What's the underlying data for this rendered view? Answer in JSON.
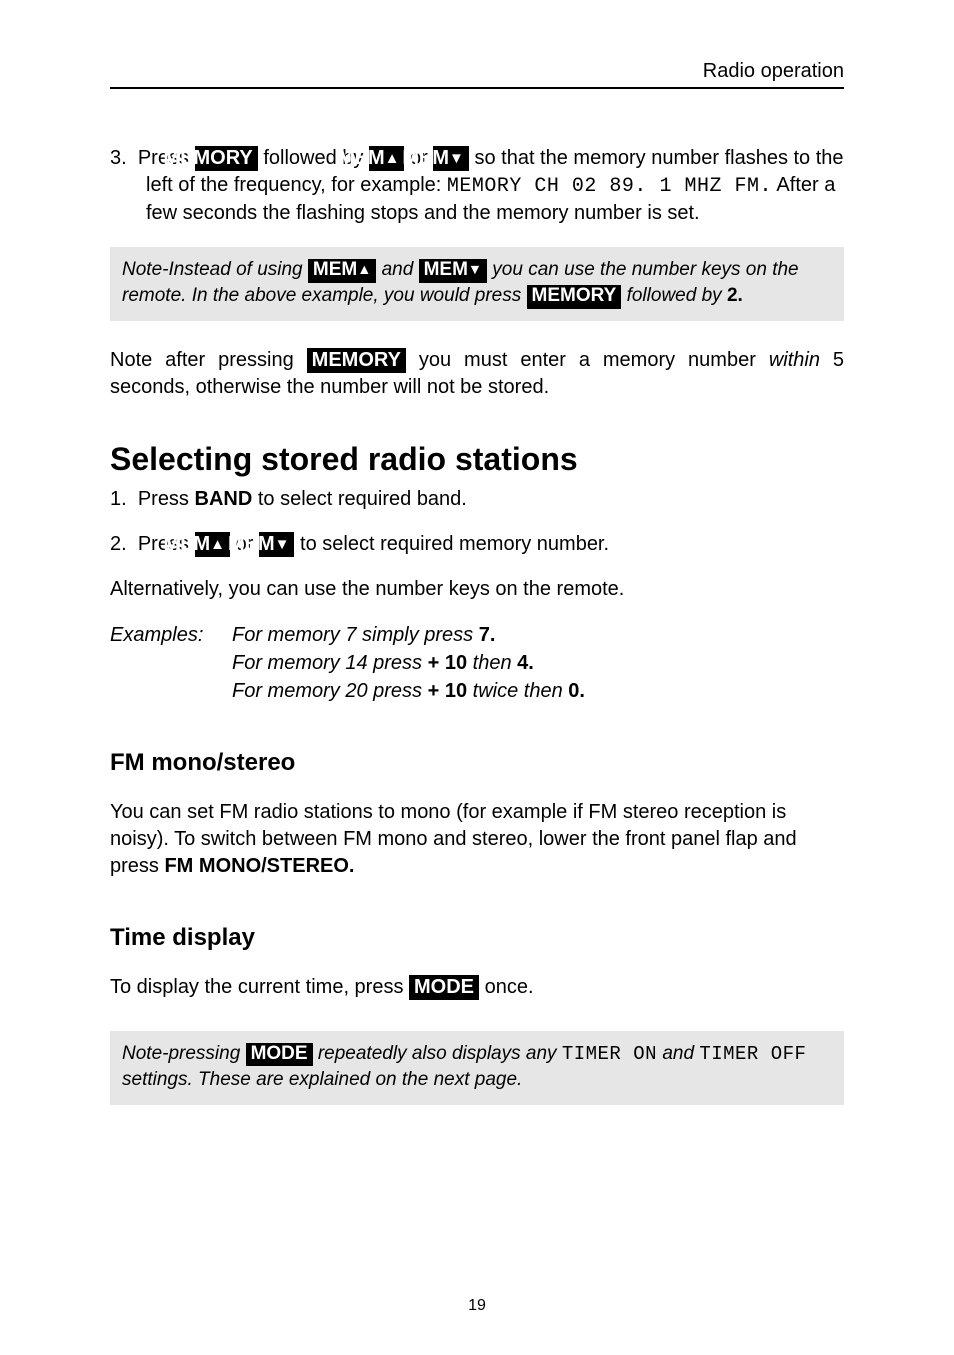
{
  "header": {
    "title": "Radio operation"
  },
  "step3": {
    "num": "3.",
    "t1": "Press ",
    "btn_memory": "MEMORY",
    "t2": " followed by ",
    "btn_memup": "MEM",
    "t3": " or ",
    "btn_memdown": "MEM",
    "t4": " so that the memory number flashes to the left of the frequency, for example: ",
    "seg": "MEMORY CH 02 89. 1 MHZ FM.",
    "t5": " After a few seconds the flashing stops and the memory number is set."
  },
  "note1": {
    "t1": "Note-Instead of using ",
    "btn_memup": "MEM",
    "t2": " and ",
    "btn_memdown": "MEM",
    "t3": " you can use the number keys on the remote. In the above example, you would press ",
    "btn_memory": "MEMORY",
    "t4": " followed by ",
    "two": "2."
  },
  "after": {
    "t1": "Note after pressing ",
    "btn_memory": "MEMORY",
    "t2": " you must enter a memory number ",
    "within": "within",
    "t3": " 5 seconds, otherwise the number will not be stored."
  },
  "sel": {
    "heading": "Selecting stored radio stations",
    "l1_num": "1.",
    "l1_a": "Press ",
    "l1_band": "BAND",
    "l1_b": " to select required band.",
    "l2_num": "2.",
    "l2_a": "Press ",
    "btn_memup": "MEM",
    "l2_b": " or ",
    "btn_memdown": "MEM",
    "l2_c": " to select required memory number.",
    "alt": "Alternatively, you can use the number keys on the remote.",
    "ex_label": "Examples:",
    "ex1_a": "For memory 7 simply press ",
    "ex1_b": "7.",
    "ex2_a": "For memory 14 press ",
    "ex2_b": "+ 10",
    "ex2_c": " then ",
    "ex2_d": "4.",
    "ex3_a": "For memory 20 press ",
    "ex3_b": "+ 10",
    "ex3_c": " twice then ",
    "ex3_d": "0."
  },
  "fm": {
    "heading": "FM mono/stereo",
    "body_a": "You can set FM radio stations to mono (for example if FM stereo reception is noisy). To switch between FM mono and stereo, lower the front panel flap and press ",
    "body_b": "FM MONO/STEREO."
  },
  "time": {
    "heading": "Time display",
    "t1": "To display the current time, press ",
    "btn_mode": "MODE",
    "t2": " once."
  },
  "note2": {
    "t1": "Note-pressing ",
    "btn_mode": "MODE",
    "t2": " repeatedly also displays any ",
    "seg1": "TIMER ON",
    "t3": " and ",
    "seg2": "TIMER OFF",
    "t4": " settings. These are explained on the next page."
  },
  "footer": {
    "page": "19"
  }
}
